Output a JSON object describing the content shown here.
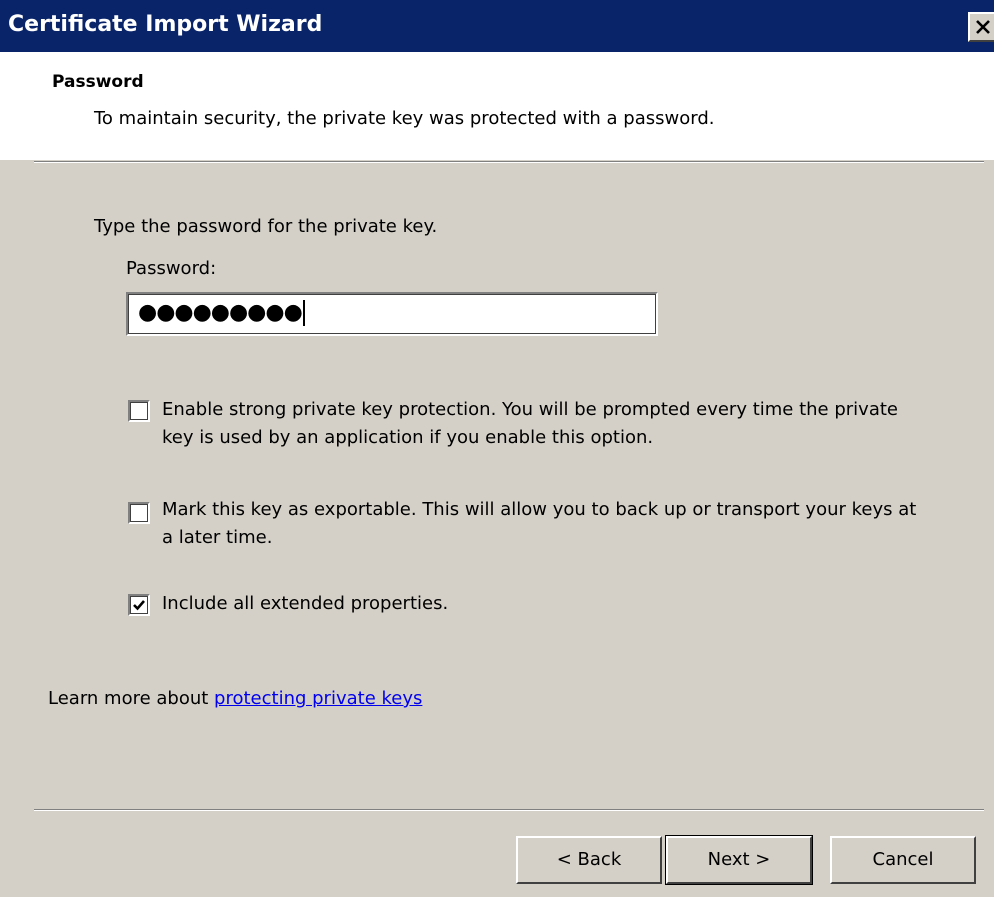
{
  "window": {
    "title": "Certificate Import Wizard",
    "close_glyph": "×"
  },
  "header": {
    "heading": "Password",
    "subheading": "To maintain security, the private key was protected with a password."
  },
  "content": {
    "instruction": "Type the password for the private key.",
    "password_label": "Password:",
    "password_masked": "●●●●●●●●●",
    "options": [
      {
        "label": "Enable strong private key protection. You will be prompted every time the private key is used by an application if you enable this option.",
        "checked": false
      },
      {
        "label": "Mark this key as exportable. This will allow you to back up or transport your keys at a later time.",
        "checked": false
      },
      {
        "label": "Include all extended properties.",
        "checked": true
      }
    ],
    "learn_prefix": "Learn more about ",
    "learn_link": "protecting private keys"
  },
  "buttons": {
    "back": "< Back",
    "next": "Next >",
    "cancel": "Cancel"
  },
  "colors": {
    "titlebar": "#0a246a",
    "face": "#d4d0c8",
    "link": "#0000ee"
  },
  "icons": {
    "close": "close-icon",
    "check": "checkmark-icon"
  }
}
